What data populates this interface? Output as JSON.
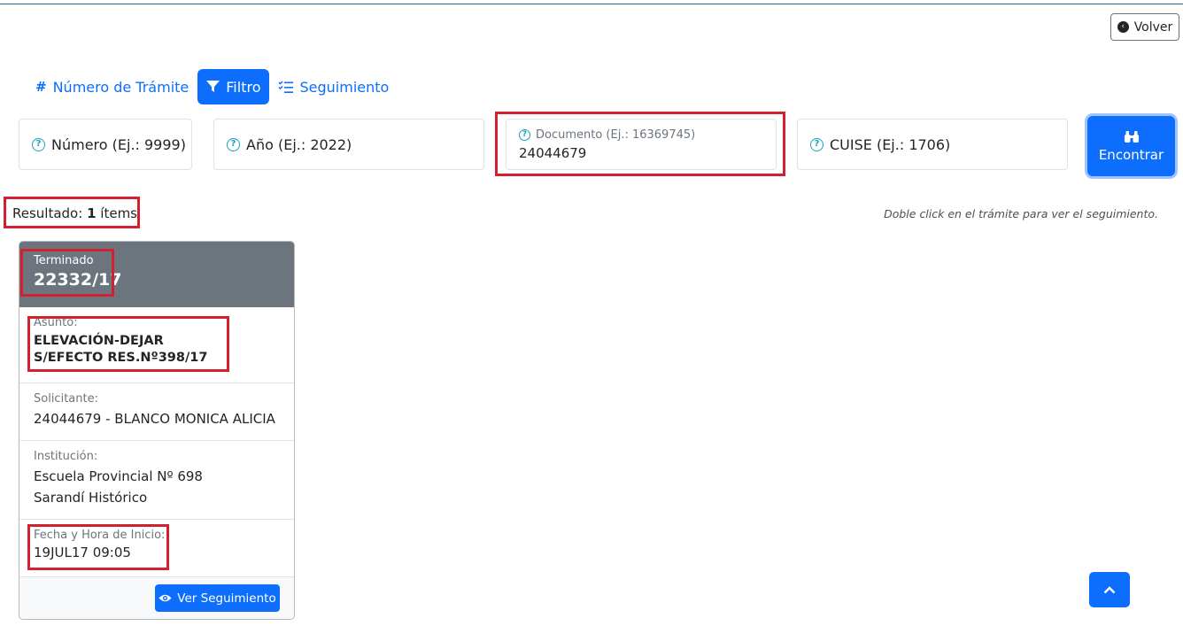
{
  "header": {
    "back_label": "Volver"
  },
  "tabs": [
    {
      "label": "Número de Trámite",
      "icon": "hash-icon"
    },
    {
      "label": "Filtro",
      "icon": "filter-icon"
    },
    {
      "label": "Seguimiento",
      "icon": "checklist-icon"
    }
  ],
  "filters": {
    "numero_placeholder": "Número (Ej.: 9999)",
    "anio_placeholder": "Año (Ej.: 2022)",
    "documento_label": "Documento (Ej.: 16369745)",
    "documento_value": "24044679",
    "cuise_placeholder": "CUISE (Ej.: 1706)",
    "find_label": "Encontrar"
  },
  "results": {
    "prefix": "Resultado:",
    "count": "1",
    "suffix": "ítems",
    "hint": "Doble click en el trámite para ver el seguimiento."
  },
  "card": {
    "status": "Terminado",
    "number": "22332/17",
    "asunto_label": "Asunto:",
    "asunto": "ELEVACIÓN-DEJAR S/EFECTO RES.Nº398/17",
    "solicitante_label": "Solicitante:",
    "solicitante": "24044679 - BLANCO MONICA ALICIA",
    "institucion_label": "Institución:",
    "institucion": "Escuela Provincial Nº 698 Sarandí Histórico",
    "fecha_label": "Fecha y Hora de Inicio:",
    "fecha": "19JUL17 09:05",
    "ver_label": "Ver Seguimiento"
  },
  "colors": {
    "primary": "#0d6efd",
    "header_gray": "#6c757d",
    "highlight": "#d3202f",
    "info": "#17a2b8"
  }
}
